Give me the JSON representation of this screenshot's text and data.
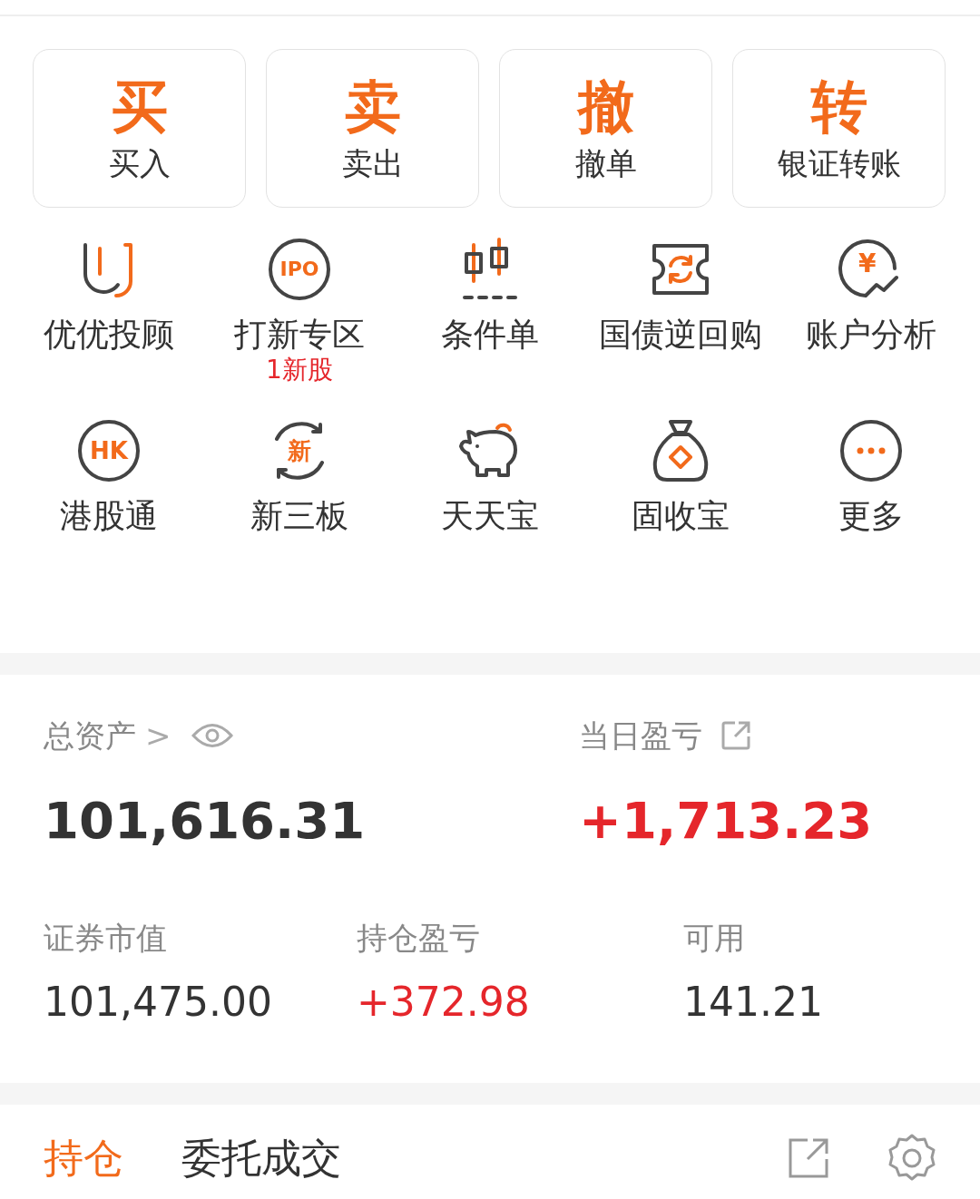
{
  "actions": [
    {
      "glyph": "买",
      "label": "买入"
    },
    {
      "glyph": "卖",
      "label": "卖出"
    },
    {
      "glyph": "撤",
      "label": "撤单"
    },
    {
      "glyph": "转",
      "label": "银证转账"
    }
  ],
  "shortcuts": [
    {
      "label": "优优投顾"
    },
    {
      "label": "打新专区",
      "icon_text": "IPO",
      "note": "1新股"
    },
    {
      "label": "条件单"
    },
    {
      "label": "国债逆回购"
    },
    {
      "label": "账户分析",
      "icon_text": "¥"
    },
    {
      "label": "港股通",
      "icon_text": "HK"
    },
    {
      "label": "新三板",
      "icon_text": "新"
    },
    {
      "label": "天天宝"
    },
    {
      "label": "固收宝"
    },
    {
      "label": "更多"
    }
  ],
  "assets": {
    "total": {
      "label": "总资产",
      "arrow": ">",
      "value": "101,616.31",
      "color": "#333333"
    },
    "today": {
      "label": "当日盈亏",
      "value": "+1,713.23",
      "color": "#e5262b"
    },
    "metrics": [
      {
        "label": "证券市值",
        "value": "101,475.00",
        "color": "#333333"
      },
      {
        "label": "持仓盈亏",
        "value": "+372.98",
        "color": "#e5262b"
      },
      {
        "label": "可用",
        "value": "141.21",
        "color": "#333333"
      }
    ]
  },
  "tabs": [
    {
      "label": "持仓",
      "selected": true
    },
    {
      "label": "委托成交",
      "selected": false
    }
  ]
}
